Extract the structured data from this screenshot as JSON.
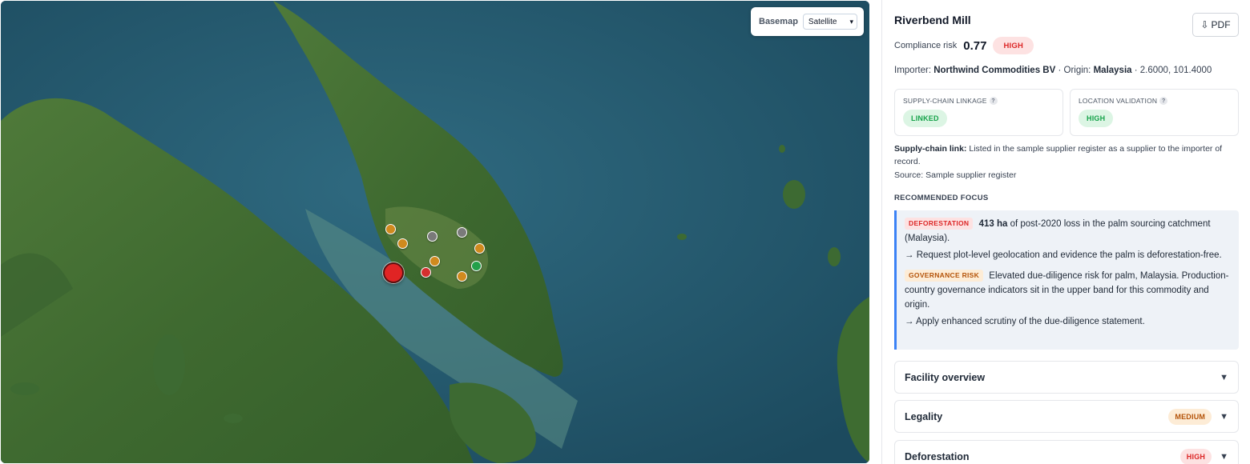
{
  "map": {
    "basemap_label": "Basemap",
    "basemap_value": "Satellite",
    "markers": [
      {
        "status": "amber",
        "color": "#d08a1e"
      },
      {
        "status": "amber",
        "color": "#d08a1e"
      },
      {
        "status": "neutral",
        "color": "#7a7a7a"
      },
      {
        "status": "neutral",
        "color": "#7a7a7a"
      },
      {
        "status": "amber",
        "color": "#d08a1e"
      },
      {
        "status": "amber",
        "color": "#d08a1e"
      },
      {
        "status": "red",
        "color": "#d32f2f"
      },
      {
        "status": "green",
        "color": "#23a04a"
      },
      {
        "status": "amber",
        "color": "#d08a1e"
      },
      {
        "status": "selected",
        "color": "#e02424"
      }
    ]
  },
  "panel": {
    "title": "Riverbend Mill",
    "pdf_icon": "download-icon",
    "pdf_label": "PDF",
    "risk_label": "Compliance risk",
    "risk_value": "0.77",
    "risk_level": "HIGH",
    "importer_label": "Importer:",
    "importer": "Northwind Commodities BV",
    "origin_label": "· Origin:",
    "origin": "Malaysia",
    "coords": "· 2.6000, 101.4000",
    "cards": [
      {
        "label": "SUPPLY-CHAIN LINKAGE",
        "value": "LINKED"
      },
      {
        "label": "LOCATION VALIDATION",
        "value": "HIGH"
      }
    ],
    "link_label": "Supply-chain link:",
    "link_text": "Listed in the sample supplier register as a supplier to the importer of record.",
    "source_text": "Source: Sample supplier register",
    "focus_heading": "RECOMMENDED FOCUS",
    "focus": {
      "defo_tag": "DEFORESTATION",
      "defo_amount": "413 ha",
      "defo_text": "of post-2020 loss in the palm sourcing catchment (Malaysia).",
      "defo_action": "→ Request plot-level geolocation and evidence the palm is deforestation-free.",
      "gov_tag": "GOVERNANCE RISK",
      "gov_text": "Elevated due-diligence risk for palm, Malaysia. Production-country governance indicators sit in the upper band for this commodity and origin.",
      "gov_action": "→ Apply enhanced scrutiny of the due-diligence statement."
    },
    "accordions": [
      {
        "title": "Facility overview",
        "badge": ""
      },
      {
        "title": "Legality",
        "badge": "MEDIUM"
      },
      {
        "title": "Deforestation",
        "badge": "HIGH"
      }
    ]
  },
  "colors": {
    "accent_blue": "#3b82f6",
    "risk_red": "#dc2626",
    "ok_green": "#16a34a",
    "warn_amber": "#b45309"
  }
}
